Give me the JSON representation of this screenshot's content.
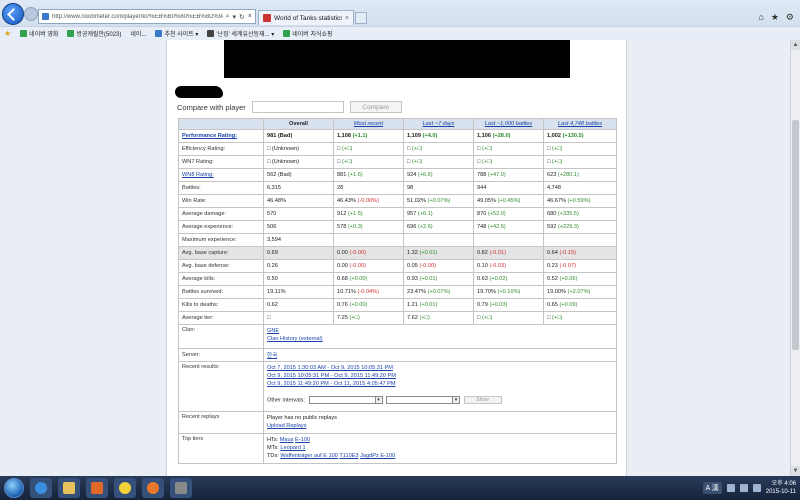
{
  "browser": {
    "address": "http://www.noobmeter.com/player/kr/%EB%B0%80%EB%8D%94%E...",
    "tabs": [
      {
        "title": "World of Tanks statistics -"
      }
    ],
    "favorites": [
      {
        "label": "네이버 영화"
      },
      {
        "label": "방공캐릴만(5023)"
      },
      {
        "label": "네이..."
      },
      {
        "label": "추천 사이트 ▾"
      },
      {
        "label": "'난징' 세계유산등재... ▾"
      },
      {
        "label": "네이버 지식쇼핑"
      }
    ]
  },
  "compare": {
    "label": "Compare with player",
    "button": "Compare"
  },
  "table": {
    "headers": [
      "",
      "Overall",
      "Most recent",
      "Last ~7 days",
      "Last ~1,000 battles",
      "Last 4,748 battles"
    ],
    "rows": [
      {
        "label": "Performance Rating:",
        "label_link": true,
        "bold": true,
        "shade": false,
        "cells": [
          {
            "v": "981 (Bad)"
          },
          {
            "v": "1,108",
            "d": "(+1.1)",
            "c": "g"
          },
          {
            "v": "1,109",
            "d": "(+4.0)",
            "c": "g"
          },
          {
            "v": "1,106",
            "d": "(+28.0)",
            "c": "g"
          },
          {
            "v": "1,002",
            "d": "(+130.5)",
            "c": "g"
          }
        ]
      },
      {
        "label": "Efficiency Rating:",
        "label_link": false,
        "bold": false,
        "shade": false,
        "cells": [
          {
            "v": "□ (Unknown)"
          },
          {
            "v": "□",
            "d": "(+□)",
            "c": "g"
          },
          {
            "v": "□",
            "d": "(+□)",
            "c": "g"
          },
          {
            "v": "□",
            "d": "(+□)",
            "c": "g"
          },
          {
            "v": "□",
            "d": "(+□)",
            "c": "g"
          }
        ]
      },
      {
        "label": "WN7 Rating:",
        "label_link": false,
        "bold": false,
        "shade": false,
        "cells": [
          {
            "v": "□ (Unknown)"
          },
          {
            "v": "□",
            "d": "(+□)",
            "c": "g"
          },
          {
            "v": "□",
            "d": "(+□)",
            "c": "g"
          },
          {
            "v": "□",
            "d": "(+□)",
            "c": "g"
          },
          {
            "v": "□",
            "d": "(+□)",
            "c": "g"
          }
        ]
      },
      {
        "label": "WN8 Rating:",
        "label_link": true,
        "bold": false,
        "shade": false,
        "cells": [
          {
            "v": "562 (Bad)"
          },
          {
            "v": "881",
            "d": "(+1.6)",
            "c": "g"
          },
          {
            "v": "924",
            "d": "(+6.6)",
            "c": "g"
          },
          {
            "v": "788",
            "d": "(+47.0)",
            "c": "g"
          },
          {
            "v": "623",
            "d": "(+280.1)",
            "c": "g"
          }
        ]
      },
      {
        "label": "Battles:",
        "label_link": false,
        "bold": false,
        "shade": false,
        "cells": [
          {
            "v": "6,315"
          },
          {
            "v": "28"
          },
          {
            "v": "98"
          },
          {
            "v": "944"
          },
          {
            "v": "4,748"
          }
        ]
      },
      {
        "label": "Win Rate:",
        "label_link": false,
        "bold": false,
        "shade": false,
        "cells": [
          {
            "v": "46.48%"
          },
          {
            "v": "46.43%",
            "d": "(-0.00%)",
            "c": "r"
          },
          {
            "v": "51.02%",
            "d": "(+0.07%)",
            "c": "g"
          },
          {
            "v": "49.05%",
            "d": "(+0.45%)",
            "c": "g"
          },
          {
            "v": "46.67%",
            "d": "(+0.59%)",
            "c": "g"
          }
        ]
      },
      {
        "label": "Average damage:",
        "label_link": false,
        "bold": false,
        "shade": false,
        "cells": [
          {
            "v": "570"
          },
          {
            "v": "912",
            "d": "(+1.5)",
            "c": "g"
          },
          {
            "v": "957",
            "d": "(+6.1)",
            "c": "g"
          },
          {
            "v": "870",
            "d": "(+52.0)",
            "c": "g"
          },
          {
            "v": "680",
            "d": "(+335.5)",
            "c": "g"
          }
        ]
      },
      {
        "label": "Average experience:",
        "label_link": false,
        "bold": false,
        "shade": false,
        "cells": [
          {
            "v": "506"
          },
          {
            "v": "578",
            "d": "(+0.3)",
            "c": "g"
          },
          {
            "v": "696",
            "d": "(+2.6)",
            "c": "g"
          },
          {
            "v": "748",
            "d": "(+42.5)",
            "c": "g"
          },
          {
            "v": "592",
            "d": "(+229.3)",
            "c": "g"
          }
        ]
      },
      {
        "label": "Maximum experience:",
        "label_link": false,
        "bold": false,
        "shade": false,
        "cells": [
          {
            "v": "3,594"
          },
          {
            "v": ""
          },
          {
            "v": ""
          },
          {
            "v": ""
          },
          {
            "v": ""
          }
        ]
      },
      {
        "label": "Avg. base capture:",
        "label_link": false,
        "bold": false,
        "shade": true,
        "cells": [
          {
            "v": "0.69"
          },
          {
            "v": "0.00",
            "d": "(-0.00)",
            "c": "r"
          },
          {
            "v": "1.32",
            "d": "(+0.01)",
            "c": "g"
          },
          {
            "v": "0.82",
            "d": "(-0.01)",
            "c": "r"
          },
          {
            "v": "0.64",
            "d": "(-0.15)",
            "c": "r"
          }
        ]
      },
      {
        "label": "Avg. base defense:",
        "label_link": false,
        "bold": false,
        "shade": false,
        "cells": [
          {
            "v": "0.26"
          },
          {
            "v": "0.00",
            "d": "(-0.00)",
            "c": "r"
          },
          {
            "v": "0.05",
            "d": "(-0.00)",
            "c": "r"
          },
          {
            "v": "0.10",
            "d": "(-0.03)",
            "c": "r"
          },
          {
            "v": "0.23",
            "d": "(-0.07)",
            "c": "r"
          }
        ]
      },
      {
        "label": "Average kills:",
        "label_link": false,
        "bold": false,
        "shade": false,
        "cells": [
          {
            "v": "0.50"
          },
          {
            "v": "0.68",
            "d": "(+0.00)",
            "c": "g"
          },
          {
            "v": "0.93",
            "d": "(+0.01)",
            "c": "g"
          },
          {
            "v": "0.63",
            "d": "(+0.02)",
            "c": "g"
          },
          {
            "v": "0.52",
            "d": "(+0.06)",
            "c": "g"
          }
        ]
      },
      {
        "label": "Battles survived:",
        "label_link": false,
        "bold": false,
        "shade": false,
        "cells": [
          {
            "v": "19.11%"
          },
          {
            "v": "10.71%",
            "d": "(-0.04%)",
            "c": "r"
          },
          {
            "v": "23.47%",
            "d": "(+0.07%)",
            "c": "g"
          },
          {
            "v": "19.70%",
            "d": "(+0.10%)",
            "c": "g"
          },
          {
            "v": "19.00%",
            "d": "(+2.07%)",
            "c": "g"
          }
        ]
      },
      {
        "label": "Kills to deaths:",
        "label_link": false,
        "bold": false,
        "shade": false,
        "cells": [
          {
            "v": "0.62"
          },
          {
            "v": "0.76",
            "d": "(+0.00)",
            "c": "g"
          },
          {
            "v": "1.21",
            "d": "(+0.01)",
            "c": "g"
          },
          {
            "v": "0.79",
            "d": "(+0.03)",
            "c": "g"
          },
          {
            "v": "0.65",
            "d": "(+0.09)",
            "c": "g"
          }
        ]
      },
      {
        "label": "Average tier:",
        "label_link": false,
        "bold": false,
        "shade": false,
        "cells": [
          {
            "v": "□"
          },
          {
            "v": "7.25",
            "d": "(+□)",
            "c": "g"
          },
          {
            "v": "7.62",
            "d": "(+□)",
            "c": "g"
          },
          {
            "v": "□",
            "d": "(+□)",
            "c": "g"
          },
          {
            "v": "□",
            "d": "(+□)",
            "c": "g"
          }
        ]
      }
    ]
  },
  "info": {
    "clan_label": "Clan:",
    "clan_name": "GNE",
    "clan_history": "Clan History (external)",
    "server_label": "Server:",
    "server_value": "한국",
    "recent_label": "Recent results:",
    "recent_links": [
      "Oct 7, 2015 1:30:03 AM - Oct 9, 2015 10:05:31 PM",
      "Oct 9, 2015 10:05:31 PM - Oct 9, 2015 11:49:20 PM",
      "Oct 9, 2015 11:49:20 PM - Oct 11, 2015 4:05:47 PM"
    ],
    "other_intervals": "Other intervals:",
    "show_button": "Show",
    "replays_label": "Recent replays",
    "replays_text": "Player has no public replays",
    "upload_replays": "Upload Replays",
    "top_tiers_label": "Top tiers",
    "hts_label": "HTs:",
    "hts": [
      "Maus",
      "E-100"
    ],
    "mts_label": "MTs:",
    "mts": [
      "Leopard 1"
    ],
    "tds_label": "TDs:",
    "tds": [
      "Waffenträger auf E 100",
      "T110E3",
      "JagdPz E-100"
    ]
  },
  "taskbar": {
    "ime": "A 漢",
    "time": "오후 4:06",
    "date": "2015-10-11"
  }
}
